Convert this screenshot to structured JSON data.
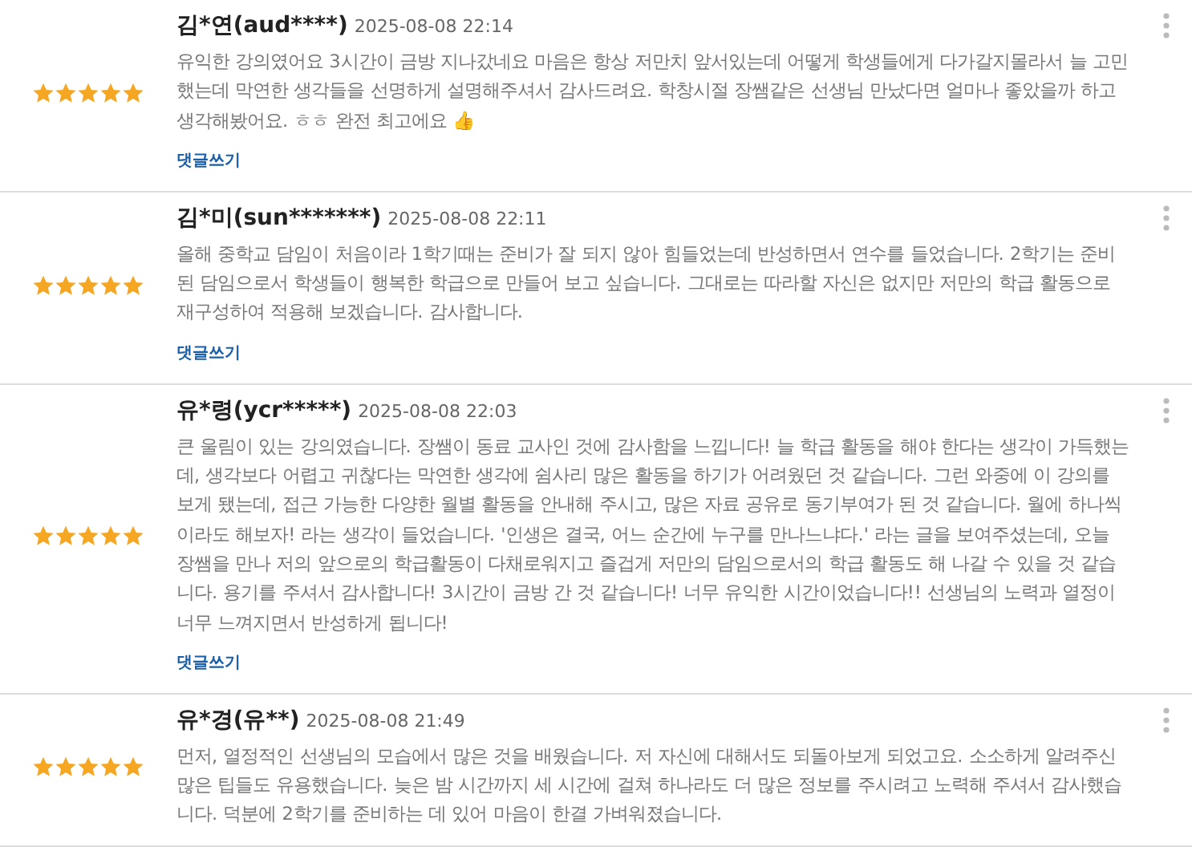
{
  "reviews": [
    {
      "author": "김*연(aud****)",
      "date": "2025-08-08 22:14",
      "stars": 5,
      "text": "유익한 강의였어요 3시간이 금방 지나갔네요 마음은 항상 저만치 앞서있는데 어떻게 학생들에게 다가갈지몰라서 늘 고민했는데 막연한 생각들을 선명하게 설명해주셔서 감사드려요. 학창시절 장쌤같은 선생님 만났다면 얼마나 좋았을까 하고 생각해봤어요. ㅎㅎ 완전 최고에요 👍",
      "reply_link": "댓글쓰기"
    },
    {
      "author": "김*미(sun*******)",
      "date": "2025-08-08 22:11",
      "stars": 5,
      "text": "올해 중학교 담임이 처음이라 1학기때는 준비가 잘 되지 않아 힘들었는데 반성하면서 연수를 들었습니다. 2학기는 준비된 담임으로서 학생들이 행복한 학급으로 만들어 보고 싶습니다. 그대로는 따라할 자신은 없지만 저만의 학급 활동으로 재구성하여 적용해 보겠습니다. 감사합니다.",
      "reply_link": "댓글쓰기"
    },
    {
      "author": "유*령(ycr*****)",
      "date": "2025-08-08 22:03",
      "stars": 5,
      "text": "큰 울림이 있는 강의였습니다. 장쌤이 동료 교사인 것에 감사함을 느낍니다! 늘 학급 활동을 해야 한다는 생각이 가득했는데, 생각보다 어렵고 귀찮다는 막연한 생각에 쉼사리 많은 활동을 하기가 어려웠던 것 같습니다. 그런 와중에 이 강의를 보게 됐는데, 접근 가능한 다양한 월별 활동을 안내해 주시고, 많은 자료 공유로 동기부여가 된 것 같습니다. 월에 하나씩이라도 해보자! 라는 생각이 들었습니다. '인생은 결국, 어느 순간에 누구를 만나느냐다.' 라는 글을 보여주셨는데, 오늘 장쌤을 만나 저의 앞으로의 학급활동이 다채로워지고 즐겁게 저만의 담임으로서의 학급 활동도 해 나갈 수 있을 것 같습니다. 용기를 주셔서 감사합니다! 3시간이 금방 간 것 같습니다! 너무 유익한 시간이었습니다!! 선생님의 노력과 열정이 너무 느껴지면서 반성하게 됩니다!",
      "reply_link": "댓글쓰기"
    },
    {
      "author": "유*경(유**)",
      "date": "2025-08-08 21:49",
      "stars": 5,
      "text": "먼저, 열정적인 선생님의 모습에서 많은 것을 배웠습니다. 저 자신에 대해서도 되돌아보게 되었고요. 소소하게 알려주신 많은 팁들도 유용했습니다. 늦은 밤 시간까지 세 시간에 걸쳐 하나라도 더 많은 정보를 주시려고 노력해 주셔서 감사했습니다. 덕분에 2학기를 준비하는 데 있어 마음이 한결 가벼워졌습니다."
    }
  ]
}
